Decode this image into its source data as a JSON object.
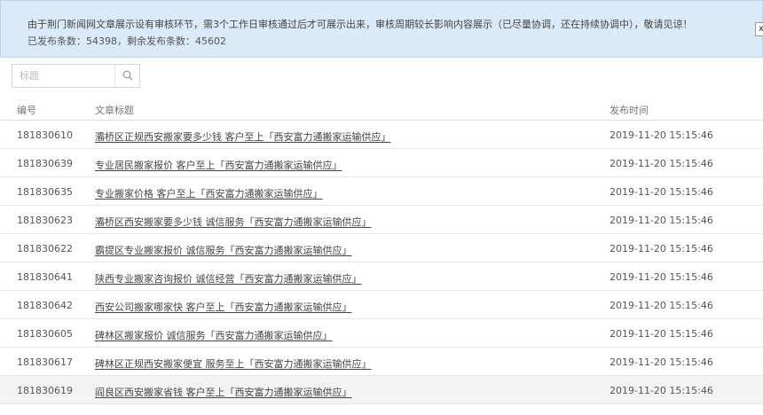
{
  "notice": {
    "line1": "由于荆门新闻网文章展示设有审核环节，需3个工作日审核通过后才可展示出来，审核周期较长影响内容展示（已尽量协调，还在持续协调中），敬请见谅！",
    "line2": "已发布条数：54398，剩余发布条数：45602",
    "close_label": "x"
  },
  "search": {
    "placeholder": "标题",
    "icon": "search-icon"
  },
  "table": {
    "headers": {
      "id": "编号",
      "title": "文章标题",
      "time": "发布时间"
    },
    "rows": [
      {
        "id": "181830610",
        "title": "灞桥区正规西安搬家要多少钱 客户至上「西安富力通搬家运输供应」",
        "time": "2019-11-20 15:15:46"
      },
      {
        "id": "181830639",
        "title": "专业居民搬家报价 客户至上「西安富力通搬家运输供应」",
        "time": "2019-11-20 15:15:46"
      },
      {
        "id": "181830635",
        "title": "专业搬家价格 客户至上「西安富力通搬家运输供应」",
        "time": "2019-11-20 15:15:46"
      },
      {
        "id": "181830623",
        "title": "灞桥区西安搬家要多少钱 诚信服务「西安富力通搬家运输供应」",
        "time": "2019-11-20 15:15:46"
      },
      {
        "id": "181830622",
        "title": "霸提区专业搬家报价 诚信服务「西安富力通搬家运输供应」",
        "time": "2019-11-20 15:15:46"
      },
      {
        "id": "181830641",
        "title": "陕西专业搬家咨询报价 诚信经营「西安富力通搬家运输供应」",
        "time": "2019-11-20 15:15:46"
      },
      {
        "id": "181830642",
        "title": "西安公司搬家哪家快 客户至上「西安富力通搬家运输供应」",
        "time": "2019-11-20 15:15:46"
      },
      {
        "id": "181830605",
        "title": "碑林区搬家报价 诚信服务「西安富力通搬家运输供应」",
        "time": "2019-11-20 15:15:46"
      },
      {
        "id": "181830617",
        "title": "碑林区正规西安搬家便宜 服务至上「西安富力通搬家运输供应」",
        "time": "2019-11-20 15:15:46"
      },
      {
        "id": "181830619",
        "title": "阎良区西安搬家省钱 客户至上「西安富力通搬家运输供应」",
        "time": "2019-11-20 15:15:46"
      }
    ]
  }
}
